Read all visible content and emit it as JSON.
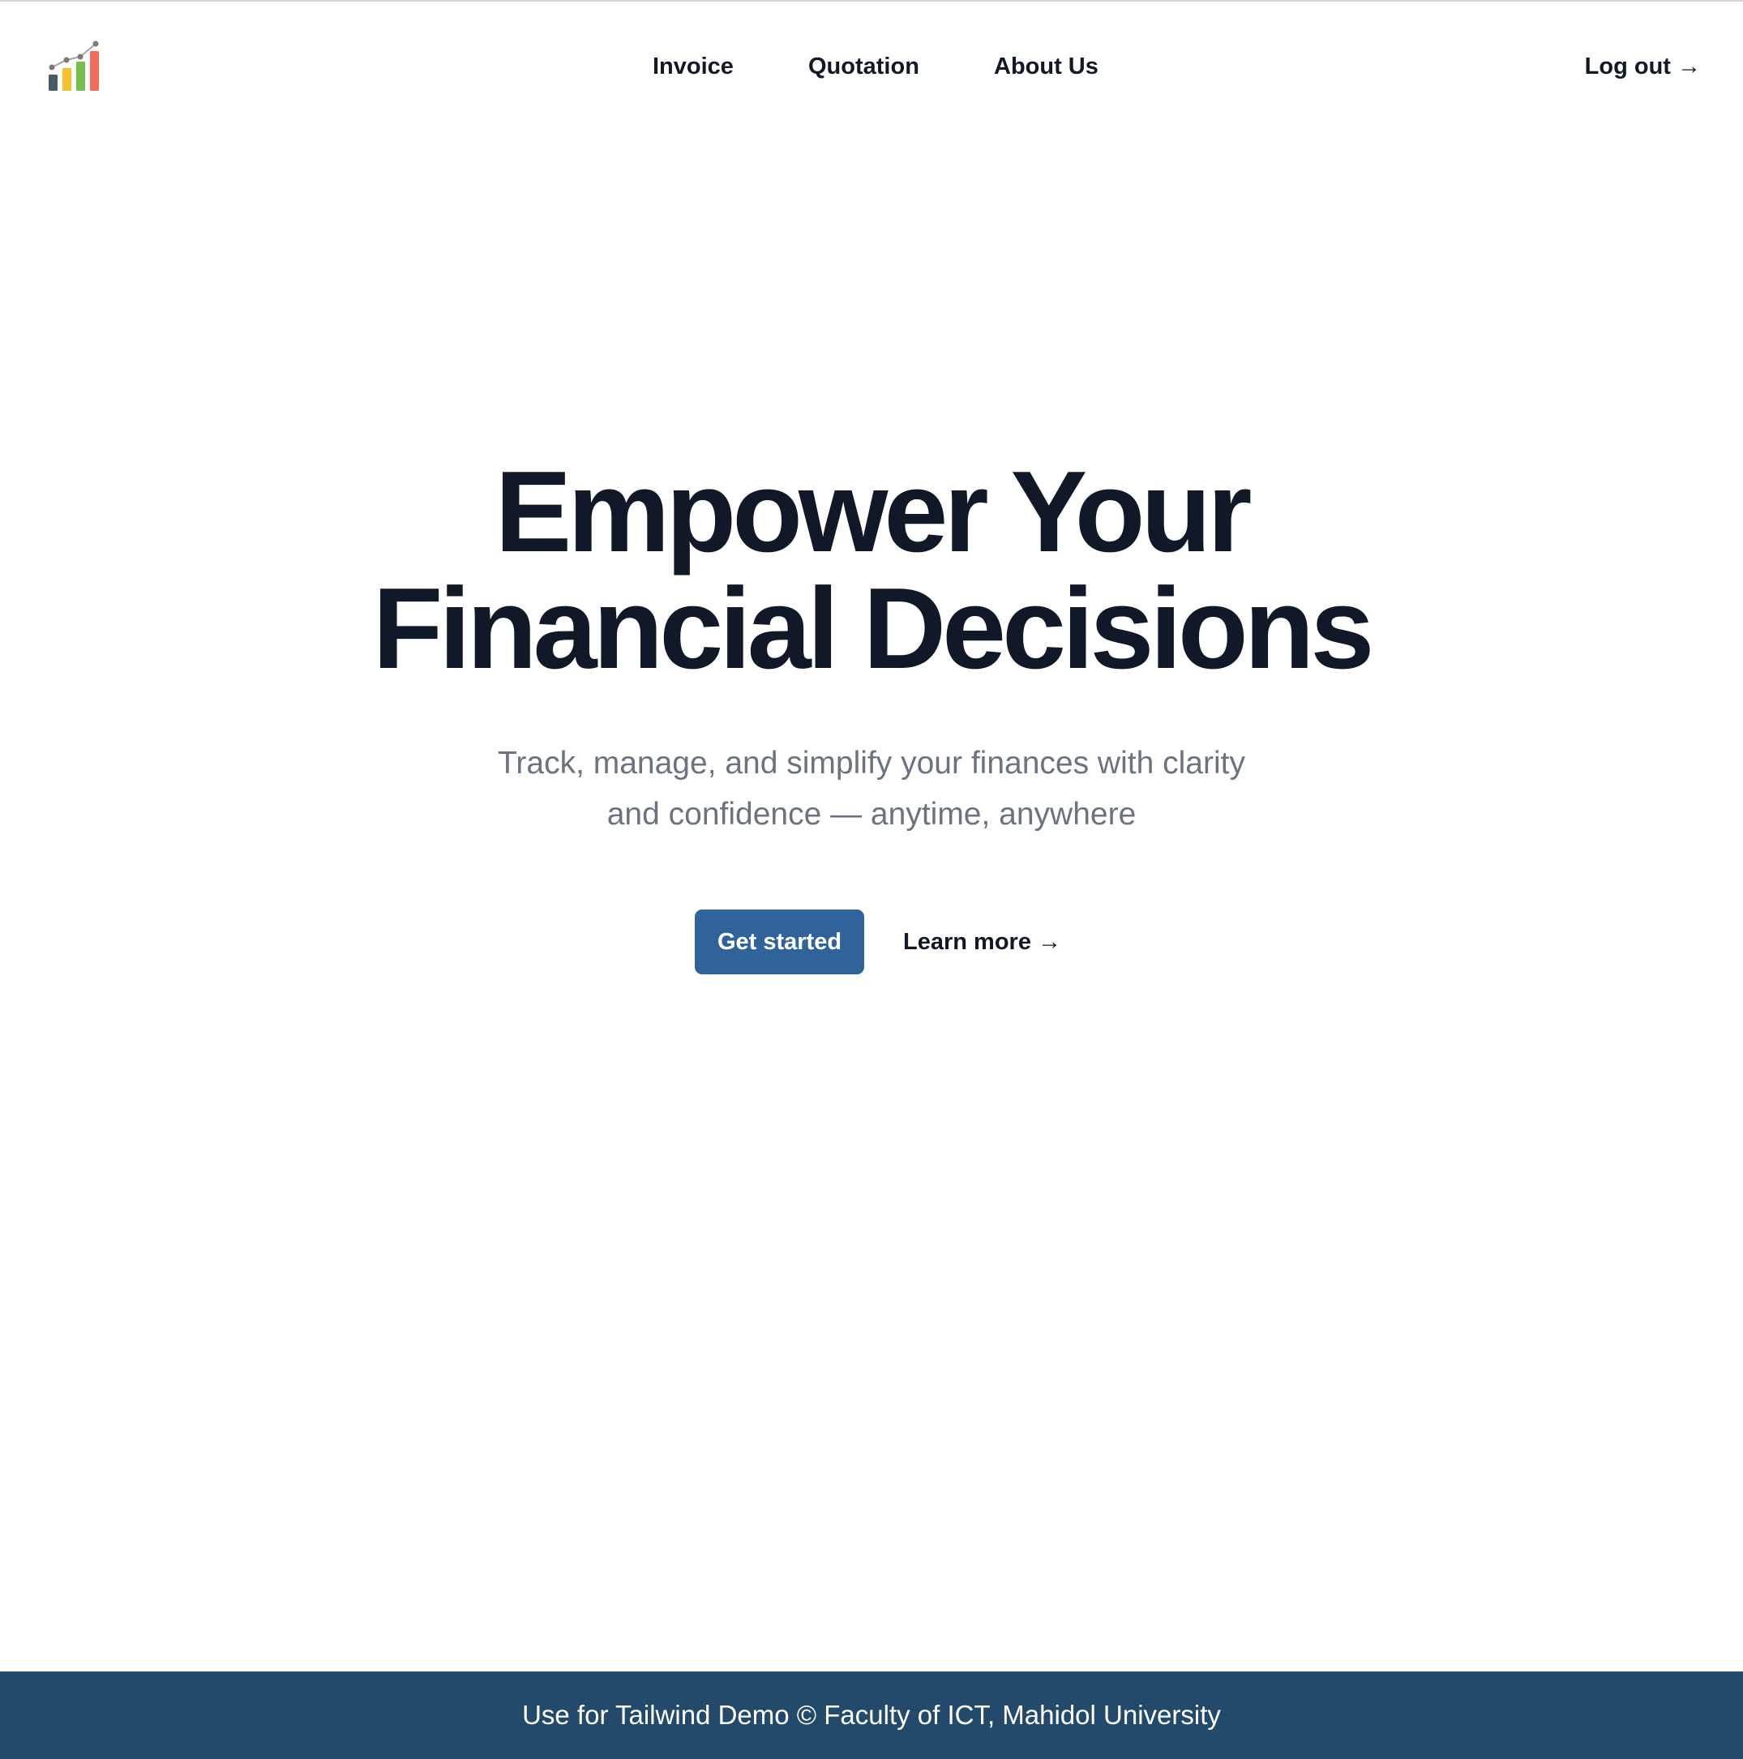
{
  "header": {
    "logo_icon": "bar-chart-growth-icon",
    "nav": [
      {
        "label": "Invoice"
      },
      {
        "label": "Quotation"
      },
      {
        "label": "About Us"
      }
    ],
    "logout_label": "Log out →"
  },
  "hero": {
    "title_line1": "Empower Your",
    "title_line2": "Financial Decisions",
    "subtitle_line1": "Track, manage, and simplify your finances with clarity",
    "subtitle_line2": "and confidence — anytime, anywhere",
    "primary_cta": "Get started",
    "secondary_cta": "Learn more →"
  },
  "footer": {
    "text": "Use for Tailwind Demo © Faculty of ICT, Mahidol University"
  },
  "colors": {
    "primary_button": "#2f6399",
    "footer_bg": "#234a6b",
    "heading": "#111827",
    "muted_text": "#6b7280"
  }
}
